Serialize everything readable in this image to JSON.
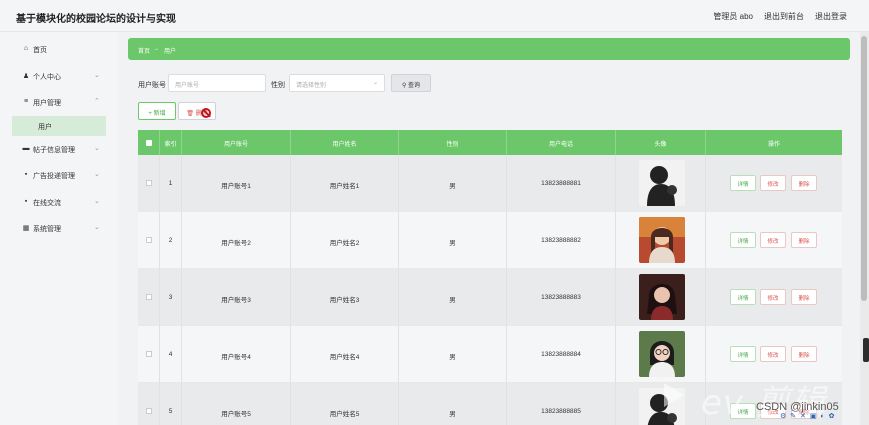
{
  "app": {
    "title": "基于模块化的校园论坛的设计与实现",
    "user_label": "管理员 abo",
    "to_frontend": "退出到前台",
    "logout": "退出登录"
  },
  "sidebar": {
    "items": [
      {
        "label": "首页",
        "icon": "home-icon",
        "has_chevron": false
      },
      {
        "label": "个人中心",
        "icon": "person-icon",
        "has_chevron": true
      },
      {
        "label": "用户管理",
        "icon": "list-icon",
        "has_chevron": true
      },
      {
        "label": "帖子信息管理",
        "icon": "post-icon",
        "has_chevron": true
      },
      {
        "label": "广告投递管理",
        "icon": "grid-icon",
        "has_chevron": true
      },
      {
        "label": "在线交流",
        "icon": "grid-icon",
        "has_chevron": true
      },
      {
        "label": "系统管理",
        "icon": "table-icon",
        "has_chevron": true
      }
    ],
    "active_sub": "用户"
  },
  "breadcrumb": {
    "home": "首页",
    "sep": "→",
    "current": "用户"
  },
  "filters": {
    "account_label": "用户账号",
    "account_placeholder": "用户账号",
    "gender_label": "性别",
    "gender_placeholder": "请选择性别",
    "search_label": "查询"
  },
  "actions": {
    "add_label": "新增",
    "delete_label": "删除"
  },
  "table": {
    "headers": [
      "索引",
      "用户账号",
      "用户姓名",
      "性别",
      "用户电话",
      "头像",
      "操作"
    ],
    "rows": [
      {
        "index": "1",
        "account": "用户账号1",
        "name": "用户姓名1",
        "gender": "男",
        "phone": "13823888881",
        "avatar": "silhouette-avatar"
      },
      {
        "index": "2",
        "account": "用户账号2",
        "name": "用户姓名2",
        "gender": "男",
        "phone": "13823888882",
        "avatar": "girl-avatar"
      },
      {
        "index": "3",
        "account": "用户账号3",
        "name": "用户姓名3",
        "gender": "男",
        "phone": "13823888883",
        "avatar": "girl-avatar"
      },
      {
        "index": "4",
        "account": "用户账号4",
        "name": "用户姓名4",
        "gender": "男",
        "phone": "13823888884",
        "avatar": "glasses-avatar"
      },
      {
        "index": "5",
        "account": "用户账号5",
        "name": "用户姓名5",
        "gender": "男",
        "phone": "13823888885",
        "avatar": "silhouette-avatar"
      }
    ],
    "row_actions": {
      "detail": "详情",
      "edit": "修改",
      "delete": "删除"
    }
  },
  "watermark": {
    "brand": "ev 剪辑",
    "csdn": "CSDN @jinkin05"
  },
  "colors": {
    "accent": "#6cc76a",
    "danger": "#d9534f",
    "sidebar_bg": "#f4f5f7"
  }
}
